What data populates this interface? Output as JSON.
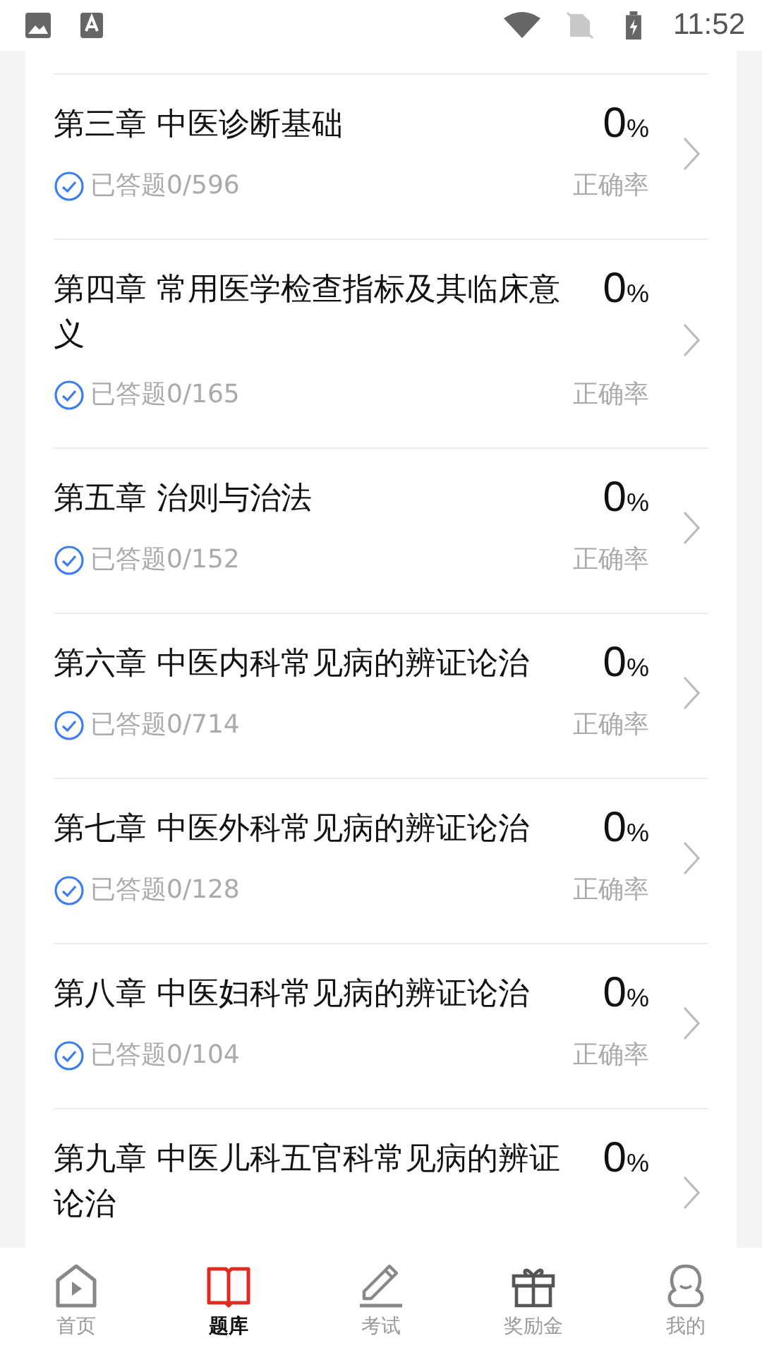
{
  "status_bar": {
    "time": "11:52"
  },
  "chapters": [
    {
      "title": "第三章 中医诊断基础",
      "percent": "0",
      "unit": "%",
      "answered": "已答题0/596",
      "accuracy_label": "正确率"
    },
    {
      "title": "第四章 常用医学检查指标及其临床意义",
      "percent": "0",
      "unit": "%",
      "answered": "已答题0/165",
      "accuracy_label": "正确率"
    },
    {
      "title": "第五章 治则与治法",
      "percent": "0",
      "unit": "%",
      "answered": "已答题0/152",
      "accuracy_label": "正确率"
    },
    {
      "title": "第六章 中医内科常见病的辨证论治",
      "percent": "0",
      "unit": "%",
      "answered": "已答题0/714",
      "accuracy_label": "正确率"
    },
    {
      "title": "第七章 中医外科常见病的辨证论治",
      "percent": "0",
      "unit": "%",
      "answered": "已答题0/128",
      "accuracy_label": "正确率"
    },
    {
      "title": "第八章 中医妇科常见病的辨证论治",
      "percent": "0",
      "unit": "%",
      "answered": "已答题0/104",
      "accuracy_label": "正确率"
    },
    {
      "title": "第九章 中医儿科五官科常见病的辨证论治",
      "percent": "0",
      "unit": "%"
    }
  ],
  "bottom_nav": [
    {
      "label": "首页",
      "kind": "home",
      "selected": false
    },
    {
      "label": "题库",
      "kind": "book",
      "selected": true
    },
    {
      "label": "考试",
      "kind": "pencil",
      "selected": false
    },
    {
      "label": "奖励金",
      "kind": "gift",
      "selected": false
    },
    {
      "label": "我的",
      "kind": "face",
      "selected": false
    }
  ]
}
